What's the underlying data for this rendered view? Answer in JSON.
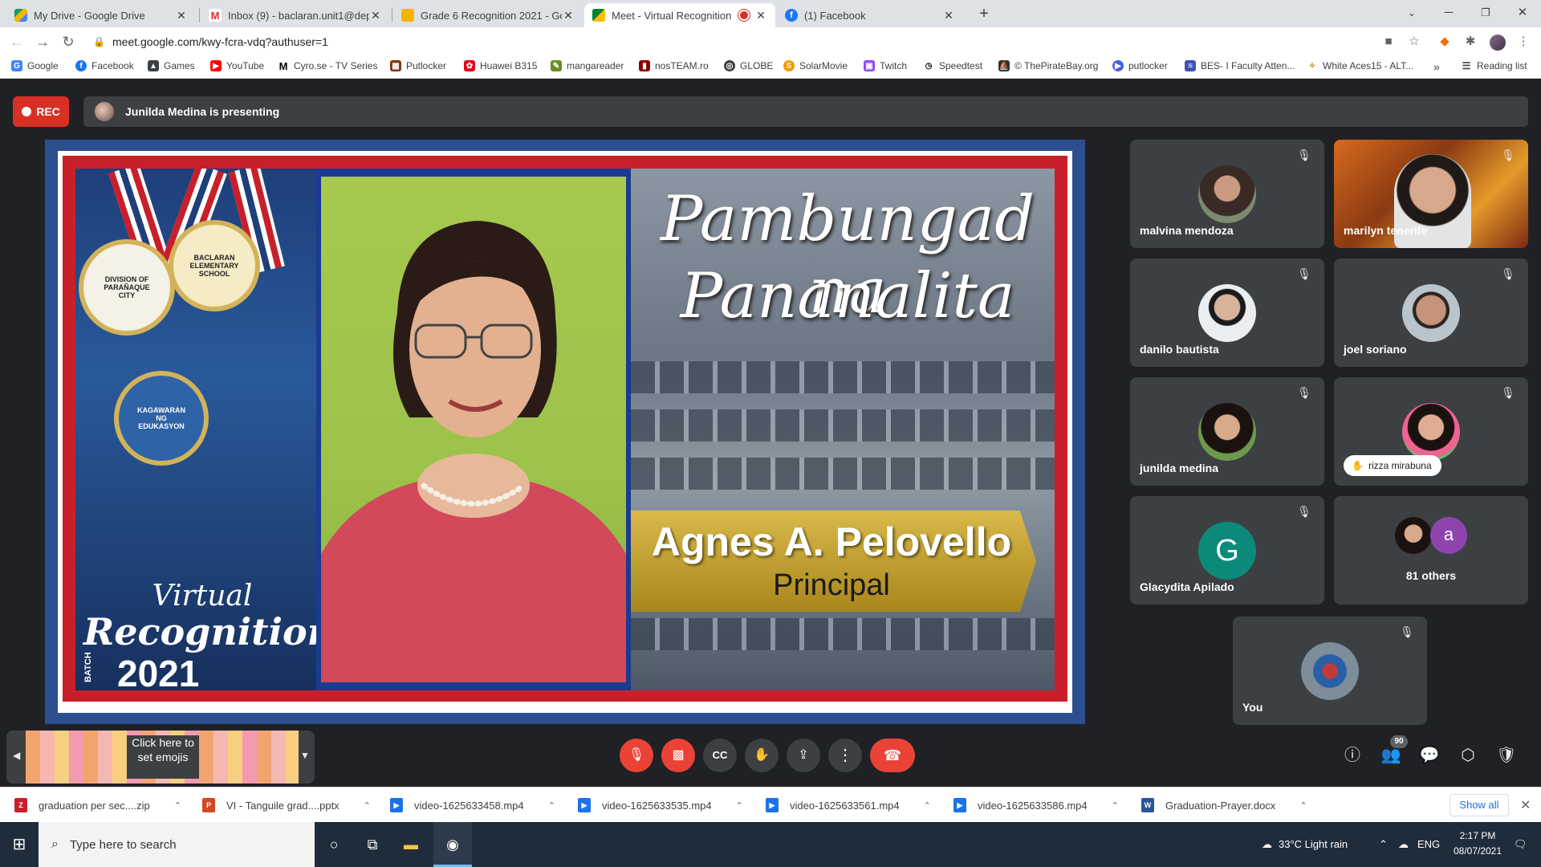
{
  "tabs": [
    {
      "title": "My Drive - Google Drive",
      "icon": "google-drive-icon"
    },
    {
      "title": "Inbox (9) - baclaran.unit1@deped",
      "icon": "gmail-icon"
    },
    {
      "title": "Grade 6 Recognition 2021 - Goo",
      "icon": "google-slides-icon"
    },
    {
      "title": "Meet - Virtual Recognition",
      "icon": "google-meet-icon",
      "active": true
    },
    {
      "title": "(1) Facebook",
      "icon": "facebook-icon"
    }
  ],
  "address": {
    "url": "meet.google.com/kwy-fcra-vdq?authuser=1"
  },
  "bookmarks": [
    "Google",
    "Facebook",
    "Games",
    "YouTube",
    "Cyro.se - TV Series",
    "Putlocker",
    "Huawei B315",
    "mangareader",
    "nosTEAM.ro",
    "GLOBE",
    "SolarMovie",
    "Twitch",
    "Speedtest",
    "© ThePirateBay.org",
    "putlocker",
    "BES- I Faculty Atten...",
    "White Aces15 - ALT...",
    "Reading list"
  ],
  "meet": {
    "rec_label": "REC",
    "presenting_text": "Junilda Medina is presenting"
  },
  "slide": {
    "title_line1": "Pambungad na",
    "title_line2": "Pananalita",
    "speaker_name": "Agnes A. Pelovello",
    "speaker_role": "Principal",
    "event_line1": "Virtual",
    "event_line2": "Recognition",
    "event_year": "2021",
    "event_batch": "BATCH"
  },
  "participants": [
    {
      "name": "malvina mendoza"
    },
    {
      "name": "marilyn tenerife"
    },
    {
      "name": "danilo bautista"
    },
    {
      "name": "joel soriano"
    },
    {
      "name": "junilda medina"
    },
    {
      "name": "rizza mirabuna"
    },
    {
      "name": "Glacydita Apilado",
      "initial": "G"
    },
    {
      "name": "81 others",
      "initial": "a"
    },
    {
      "name": "You"
    }
  ],
  "emoji": {
    "label": "Click here to set emojis"
  },
  "people_count": "90",
  "downloads": [
    {
      "name": "graduation per sec....zip",
      "color": "#c8202a"
    },
    {
      "name": "VI - Tanguile grad....pptx",
      "color": "#d24726"
    },
    {
      "name": "video-1625633458.mp4",
      "color": "#1a73e8"
    },
    {
      "name": "video-1625633535.mp4",
      "color": "#1a73e8"
    },
    {
      "name": "video-1625633561.mp4",
      "color": "#1a73e8"
    },
    {
      "name": "video-1625633586.mp4",
      "color": "#1a73e8"
    },
    {
      "name": "Graduation-Prayer.docx",
      "color": "#2b579a"
    }
  ],
  "show_all": "Show all",
  "taskbar": {
    "search_placeholder": "Type here to search",
    "weather": "33°C  Light rain",
    "lang": "ENG",
    "time": "2:17 PM",
    "date": "08/07/2021"
  }
}
